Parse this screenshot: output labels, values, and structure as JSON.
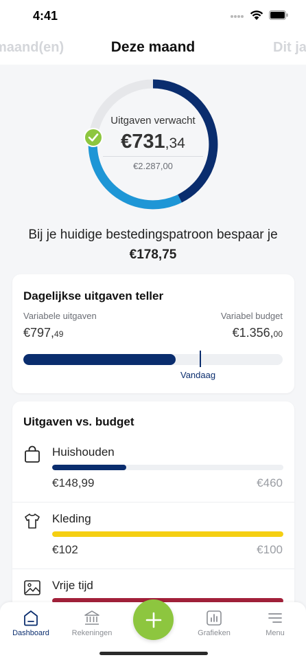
{
  "status_bar": {
    "time": "4:41"
  },
  "header": {
    "prev_period": "maand(en)",
    "current_period": "Deze maand",
    "next_period": "Dit ja"
  },
  "ring": {
    "label": "Uitgaven verwacht",
    "amount_main": "€731",
    "amount_cents": ",34",
    "total": "€2.287,00",
    "expected_fraction": 0.32,
    "colors": {
      "expected": "#0a2d6e",
      "spent": "#1e96d6",
      "remaining": "#e6e7ea",
      "check": "#8dc63f"
    }
  },
  "savings": {
    "text": "Bij je huidige bestedingspatroon bespaar je",
    "amount": "€178,75"
  },
  "daily": {
    "title": "Dagelijkse uitgaven teller",
    "variable_label": "Variabele uitgaven",
    "budget_label": "Variabel budget",
    "variable_main": "€797,",
    "variable_cents": "49",
    "budget_main": "€1.356,",
    "budget_cents": "00",
    "progress_fraction": 0.588,
    "today_label": "Vandaag"
  },
  "budget_section": {
    "title": "Uitgaven vs. budget",
    "categories": [
      {
        "name": "Huishouden",
        "spent": "€148,99",
        "budget": "€460",
        "fraction": 0.32,
        "color": "#0a2d6e",
        "icon": "shopping-bag-icon"
      },
      {
        "name": "Kleding",
        "spent": "€102",
        "budget": "€100",
        "fraction": 1.0,
        "color": "#f5cf12",
        "icon": "shirt-icon"
      },
      {
        "name": "Vrije tijd",
        "spent": "",
        "budget": "",
        "fraction": 1.0,
        "color": "#a3213a",
        "icon": "image-icon"
      }
    ]
  },
  "tabbar": {
    "tabs": [
      {
        "label": "Dashboard",
        "icon": "home-icon"
      },
      {
        "label": "Rekeningen",
        "icon": "bank-icon"
      },
      {
        "label": "Grafieken",
        "icon": "chart-icon"
      },
      {
        "label": "Menu",
        "icon": "menu-icon"
      }
    ],
    "active_tab": "Dashboard",
    "fab_icon": "plus-icon"
  }
}
